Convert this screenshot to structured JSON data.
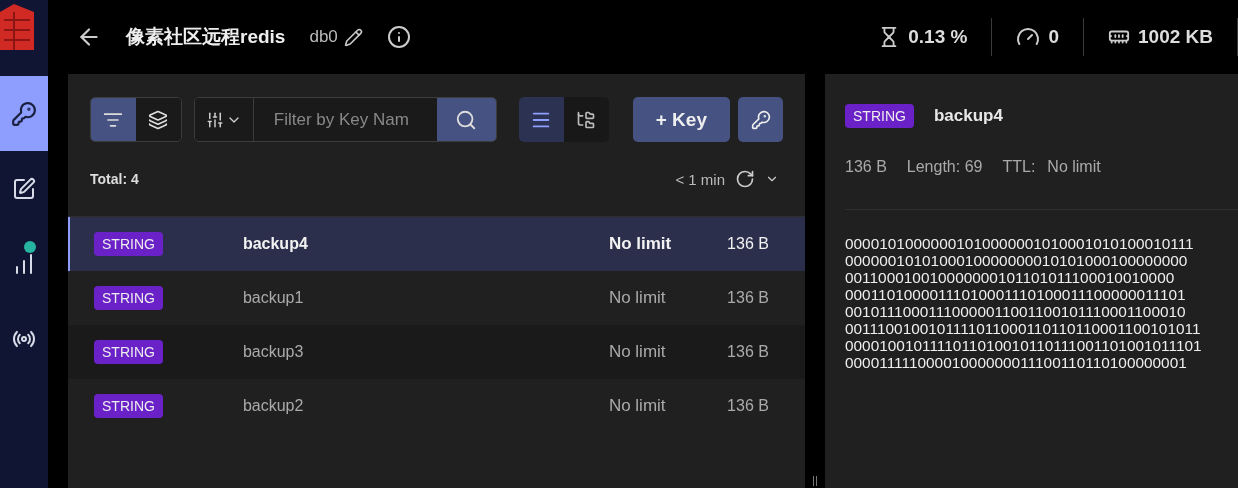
{
  "header": {
    "title": "像素社区远程redis",
    "db": "db0",
    "stats": [
      {
        "kind": "cpu",
        "value": "0.13 %"
      },
      {
        "kind": "ops",
        "value": "0"
      },
      {
        "kind": "memory",
        "value": "1002 KB"
      }
    ]
  },
  "sidebar": {
    "items": [
      {
        "kind": "browser",
        "selected": true,
        "notification": false
      },
      {
        "kind": "workbench",
        "selected": false,
        "notification": false
      },
      {
        "kind": "analytics",
        "selected": false,
        "notification": true
      },
      {
        "kind": "pubsub",
        "selected": false,
        "notification": false
      }
    ]
  },
  "browser": {
    "search_modes": [
      {
        "kind": "filter",
        "selected": true
      },
      {
        "kind": "pattern",
        "selected": false
      }
    ],
    "search": {
      "placeholder": "Filter by Key Nam"
    },
    "view_modes": [
      {
        "kind": "list",
        "selected": true
      },
      {
        "kind": "tree",
        "selected": false
      }
    ],
    "add_button": "+ Key",
    "total": "Total: 4",
    "refresh": "< 1 min",
    "rows": [
      {
        "type": "STRING",
        "name": "backup4",
        "ttl": "No limit",
        "size": "136 B",
        "selected": true
      },
      {
        "type": "STRING",
        "name": "backup1",
        "ttl": "No limit",
        "size": "136 B",
        "selected": false
      },
      {
        "type": "STRING",
        "name": "backup3",
        "ttl": "No limit",
        "size": "136 B",
        "selected": false
      },
      {
        "type": "STRING",
        "name": "backup2",
        "ttl": "No limit",
        "size": "136 B",
        "selected": false
      }
    ]
  },
  "details": {
    "type": "STRING",
    "name": "backup4",
    "size": "136 B",
    "length": "Length: 69",
    "ttl_label": "TTL:",
    "ttl": "No limit",
    "value_lines": [
      "00001010000001010000001010001010100010111",
      "0000001010100010000000010101000100000000",
      "001100010010000000101101011100010010000",
      "00011010000111010001110100011100000011101",
      "00101110001110000011001100101110001100010",
      "0011100100101111011000110110110001100101011",
      "0000100101111011010010110111001101001011101",
      "00001111100001000000011100110110100000001"
    ]
  }
}
